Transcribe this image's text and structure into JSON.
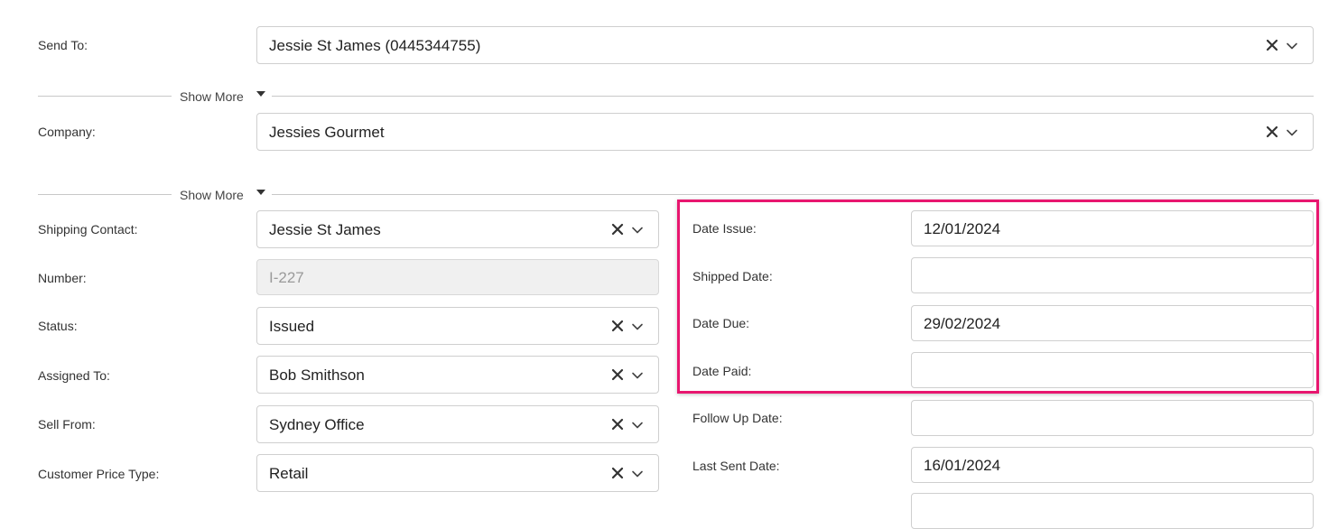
{
  "send_to": {
    "label": "Send To:",
    "value": "Jessie St James (0445344755)"
  },
  "show_more_1": {
    "label": "Show More"
  },
  "company": {
    "label": "Company:",
    "value": "Jessies Gourmet"
  },
  "show_more_2": {
    "label": "Show More"
  },
  "left_fields": {
    "shipping_contact": {
      "label": "Shipping Contact:",
      "value": "Jessie St James"
    },
    "number": {
      "label": "Number:",
      "value": "I-227"
    },
    "status": {
      "label": "Status:",
      "value": "Issued"
    },
    "assigned_to": {
      "label": "Assigned To:",
      "value": "Bob Smithson"
    },
    "sell_from": {
      "label": "Sell From:",
      "value": "Sydney Office"
    },
    "customer_price_type": {
      "label": "Customer Price Type:",
      "value": "Retail"
    }
  },
  "right_fields": {
    "date_issue": {
      "label": "Date Issue:",
      "value": "12/01/2024"
    },
    "shipped_date": {
      "label": "Shipped Date:",
      "value": ""
    },
    "date_due": {
      "label": "Date Due:",
      "value": "29/02/2024"
    },
    "date_paid": {
      "label": "Date Paid:",
      "value": ""
    },
    "follow_up_date": {
      "label": "Follow Up Date:",
      "value": ""
    },
    "last_sent_date": {
      "label": "Last Sent Date:",
      "value": "16/01/2024"
    }
  },
  "icons": {
    "clear": "clear-x-icon",
    "dropdown": "chevron-down-icon",
    "show_more": "caret-down-icon"
  },
  "colors": {
    "highlight": "#e8166f",
    "border": "#cfcfcf",
    "readonly_bg": "#f0f0f0"
  }
}
